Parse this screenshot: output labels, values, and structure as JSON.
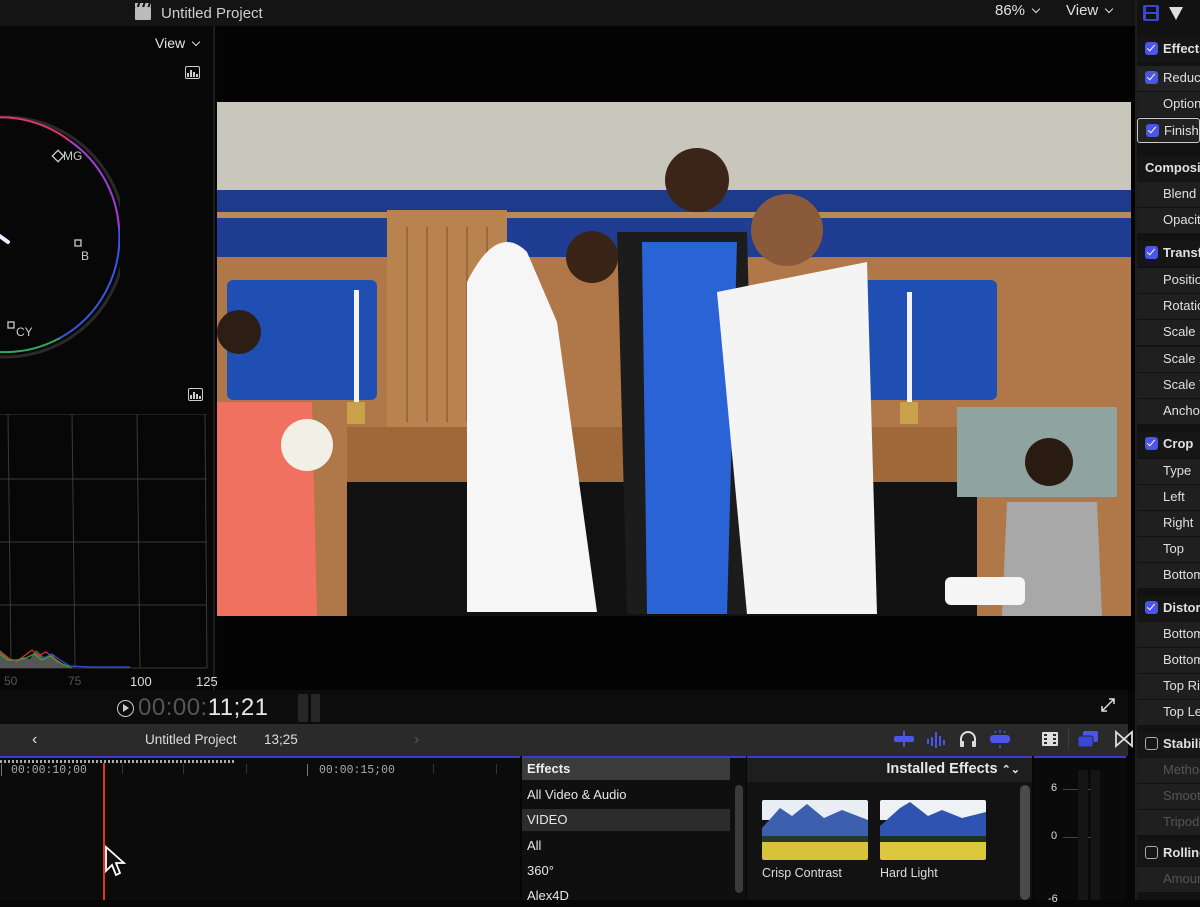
{
  "window": {
    "title": "Untitled Project",
    "title_icon": "clapperboard-icon"
  },
  "viewer": {
    "zoom": "86%",
    "view_label": "View",
    "timecode_dim": "00:00:",
    "timecode_lit": "11;21"
  },
  "scopes": {
    "view_label": "View",
    "vectorscope": {
      "targets": [
        "MG",
        "B",
        "CY"
      ],
      "ring_colors": [
        "#e0336b",
        "#a43cd8",
        "#3c54e6",
        "#2fa860"
      ]
    },
    "histogram": {
      "x_ticks": [
        "50",
        "75",
        "100",
        "125"
      ]
    }
  },
  "timeline": {
    "project_name": "Untitled Project",
    "duration": "13;25",
    "back": "‹",
    "forward": "›",
    "ruler": [
      "00:00:10;00",
      "00:00:15;00"
    ],
    "playhead_color": "#e03322",
    "tools": [
      "audio-skimming-icon",
      "audio-waveform-icon",
      "solo-headphones-icon",
      "snapping-icon",
      "clip-appearance-icon",
      "browser-toggle-icon",
      "transitions-icon"
    ]
  },
  "effects_browser": {
    "header": "Effects",
    "categories": [
      {
        "label": "All Video & Audio",
        "selected": false
      },
      {
        "label": "VIDEO",
        "selected": true
      },
      {
        "label": "All",
        "selected": false
      },
      {
        "label": "360°",
        "selected": false
      },
      {
        "label": "Alex4D",
        "selected": false
      }
    ],
    "gallery_title": "Installed Effects",
    "effects": [
      {
        "label": "Crisp Contrast"
      },
      {
        "label": "Hard Light"
      }
    ]
  },
  "audio_meter": {
    "scale": [
      "6",
      "0",
      "-6"
    ]
  },
  "inspector": {
    "accent": "#4b55e6",
    "rows": [
      {
        "label": "Effects",
        "type": "header",
        "checked": true
      },
      {
        "label": "Reduce",
        "type": "check",
        "checked": true
      },
      {
        "label": "Options",
        "type": "param"
      },
      {
        "label": "Finishing",
        "type": "check",
        "checked": true
      },
      {
        "label": "Compositing",
        "type": "header"
      },
      {
        "label": "Blend Mode",
        "type": "param"
      },
      {
        "label": "Opacity",
        "type": "param"
      },
      {
        "label": "Transform",
        "type": "header",
        "checked": true
      },
      {
        "label": "Position",
        "type": "param"
      },
      {
        "label": "Rotation",
        "type": "param"
      },
      {
        "label": "Scale (All)",
        "type": "param"
      },
      {
        "label": "Scale X",
        "type": "param"
      },
      {
        "label": "Scale Y",
        "type": "param"
      },
      {
        "label": "Anchor",
        "type": "param"
      },
      {
        "label": "Crop",
        "type": "header",
        "checked": true
      },
      {
        "label": "Type",
        "type": "param"
      },
      {
        "label": "Left",
        "type": "param"
      },
      {
        "label": "Right",
        "type": "param"
      },
      {
        "label": "Top",
        "type": "param"
      },
      {
        "label": "Bottom",
        "type": "param"
      },
      {
        "label": "Distort",
        "type": "header",
        "checked": true
      },
      {
        "label": "Bottom Left",
        "type": "param"
      },
      {
        "label": "Bottom Right",
        "type": "param"
      },
      {
        "label": "Top Right",
        "type": "param"
      },
      {
        "label": "Top Left",
        "type": "param"
      },
      {
        "label": "Stabilization",
        "type": "header",
        "checked": false
      },
      {
        "label": "Method",
        "type": "param",
        "dim": true
      },
      {
        "label": "Smoothing",
        "type": "param",
        "dim": true
      },
      {
        "label": "Tripod Mode",
        "type": "param",
        "dim": true
      },
      {
        "label": "Rolling Shutter",
        "type": "header",
        "checked": false
      },
      {
        "label": "Amount",
        "type": "param",
        "dim": true
      }
    ]
  }
}
